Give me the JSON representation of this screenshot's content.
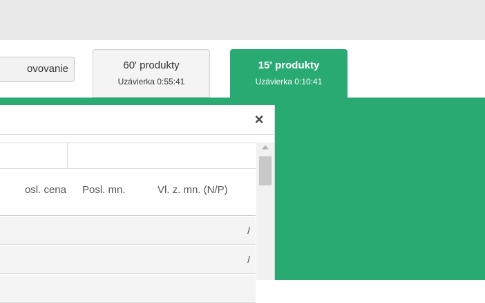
{
  "toolbar": {
    "partial_button_label": "ovovanie"
  },
  "tabs": [
    {
      "title": "60' produkty",
      "subtitle": "Uzávierka 0:55:41",
      "active": false
    },
    {
      "title": "15' produkty",
      "subtitle": "Uzávierka 0:10:41",
      "active": true
    }
  ],
  "dialog": {
    "close_icon": "×",
    "columns": [
      "osl. cena",
      "Posl. mn.",
      "Vl. z. mn. (N/P)"
    ],
    "rows": [
      {
        "vl_z_mn": "/"
      },
      {
        "vl_z_mn": "/"
      },
      {
        "vl_z_mn": ""
      }
    ]
  },
  "colors": {
    "accent": "#2aaa73",
    "topbar": "#e8e8e8"
  }
}
